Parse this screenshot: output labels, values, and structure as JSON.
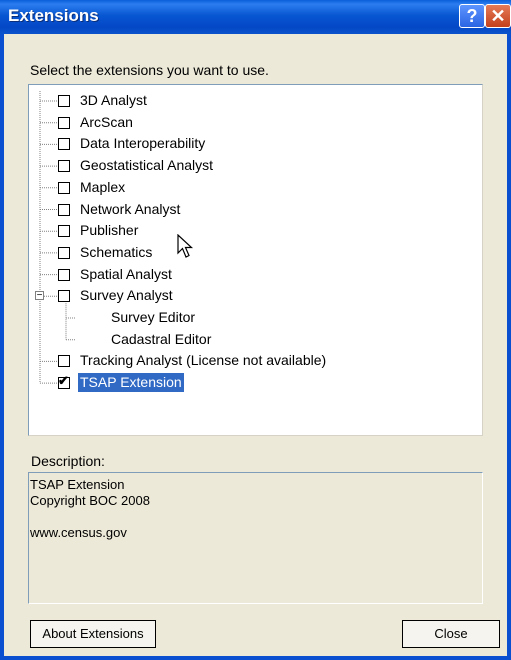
{
  "window": {
    "title": "Extensions"
  },
  "titlebar_buttons": {
    "help_glyph": "?",
    "close_glyph": "✕"
  },
  "instructions": "Select the extensions you want to use.",
  "extensions": [
    {
      "label": "3D Analyst",
      "checked": false
    },
    {
      "label": "ArcScan",
      "checked": false
    },
    {
      "label": "Data Interoperability",
      "checked": false
    },
    {
      "label": "Geostatistical Analyst",
      "checked": false
    },
    {
      "label": "Maplex",
      "checked": false
    },
    {
      "label": "Network Analyst",
      "checked": false
    },
    {
      "label": "Publisher",
      "checked": false
    },
    {
      "label": "Schematics",
      "checked": false
    },
    {
      "label": "Spatial Analyst",
      "checked": false
    },
    {
      "label": "Survey Analyst",
      "checked": false,
      "expanded": true,
      "children": [
        "Survey Editor",
        "Cadastral Editor"
      ]
    },
    {
      "label": "Tracking Analyst (License not available)",
      "checked": false
    },
    {
      "label": "TSAP Extension",
      "checked": true,
      "selected": true
    }
  ],
  "description": {
    "label": "Description:",
    "lines": [
      "TSAP Extension",
      "Copyright  BOC 2008",
      "",
      "www.census.gov"
    ]
  },
  "buttons": {
    "about": "About Extensions",
    "close": "Close"
  },
  "colors": {
    "titlebar": "#0a5fd8",
    "selection": "#316ac5",
    "dialog_bg": "#ece9d8"
  }
}
